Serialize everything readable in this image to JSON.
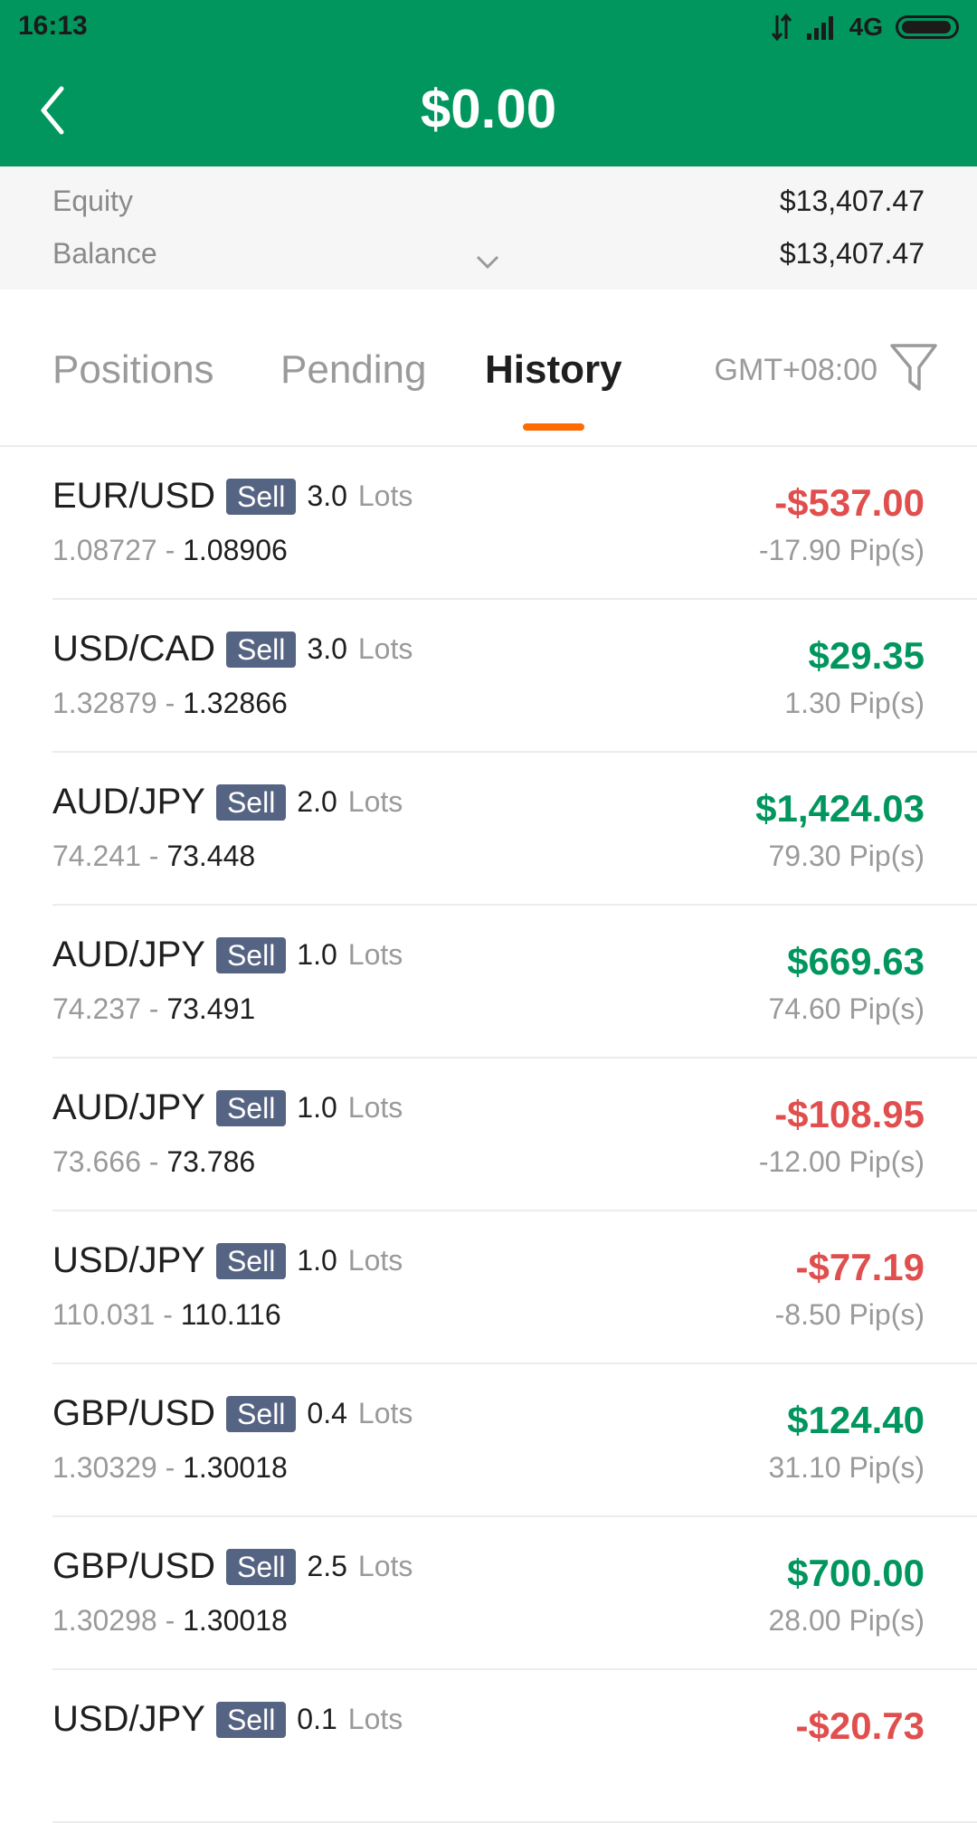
{
  "status": {
    "time": "16:13",
    "network": "4G"
  },
  "header": {
    "title": "$0.00"
  },
  "summary": {
    "equity_label": "Equity",
    "equity_value": "$13,407.47",
    "balance_label": "Balance",
    "balance_value": "$13,407.47"
  },
  "tabs": {
    "positions": "Positions",
    "pending": "Pending",
    "history": "History",
    "timezone": "GMT+08:00"
  },
  "colors": {
    "brand": "#00965e",
    "accent": "#ff6b00",
    "loss": "#e04e4e",
    "profit": "#00965e",
    "badge": "#566483"
  },
  "trades": [
    {
      "symbol": "EUR/USD",
      "side": "Sell",
      "lots": "3.0",
      "lots_label": "Lots",
      "open": "1.08727",
      "sep": " - ",
      "close": "1.08906",
      "pnl": "-$537.00",
      "pips": "-17.90 Pip(s)",
      "trend": "neg"
    },
    {
      "symbol": "USD/CAD",
      "side": "Sell",
      "lots": "3.0",
      "lots_label": "Lots",
      "open": "1.32879",
      "sep": " - ",
      "close": "1.32866",
      "pnl": "$29.35",
      "pips": "1.30 Pip(s)",
      "trend": "pos"
    },
    {
      "symbol": "AUD/JPY",
      "side": "Sell",
      "lots": "2.0",
      "lots_label": "Lots",
      "open": "74.241",
      "sep": " - ",
      "close": "73.448",
      "pnl": "$1,424.03",
      "pips": "79.30 Pip(s)",
      "trend": "pos"
    },
    {
      "symbol": "AUD/JPY",
      "side": "Sell",
      "lots": "1.0",
      "lots_label": "Lots",
      "open": "74.237",
      "sep": " - ",
      "close": "73.491",
      "pnl": "$669.63",
      "pips": "74.60 Pip(s)",
      "trend": "pos"
    },
    {
      "symbol": "AUD/JPY",
      "side": "Sell",
      "lots": "1.0",
      "lots_label": "Lots",
      "open": "73.666",
      "sep": " - ",
      "close": "73.786",
      "pnl": "-$108.95",
      "pips": "-12.00 Pip(s)",
      "trend": "neg"
    },
    {
      "symbol": "USD/JPY",
      "side": "Sell",
      "lots": "1.0",
      "lots_label": "Lots",
      "open": "110.031",
      "sep": " - ",
      "close": "110.116",
      "pnl": "-$77.19",
      "pips": "-8.50 Pip(s)",
      "trend": "neg"
    },
    {
      "symbol": "GBP/USD",
      "side": "Sell",
      "lots": "0.4",
      "lots_label": "Lots",
      "open": "1.30329",
      "sep": " - ",
      "close": "1.30018",
      "pnl": "$124.40",
      "pips": "31.10 Pip(s)",
      "trend": "pos"
    },
    {
      "symbol": "GBP/USD",
      "side": "Sell",
      "lots": "2.5",
      "lots_label": "Lots",
      "open": "1.30298",
      "sep": " - ",
      "close": "1.30018",
      "pnl": "$700.00",
      "pips": "28.00 Pip(s)",
      "trend": "pos"
    },
    {
      "symbol": "USD/JPY",
      "side": "Sell",
      "lots": "0.1",
      "lots_label": "Lots",
      "open": "",
      "sep": "",
      "close": "",
      "pnl": "-$20.73",
      "pips": "",
      "trend": "neg"
    }
  ]
}
